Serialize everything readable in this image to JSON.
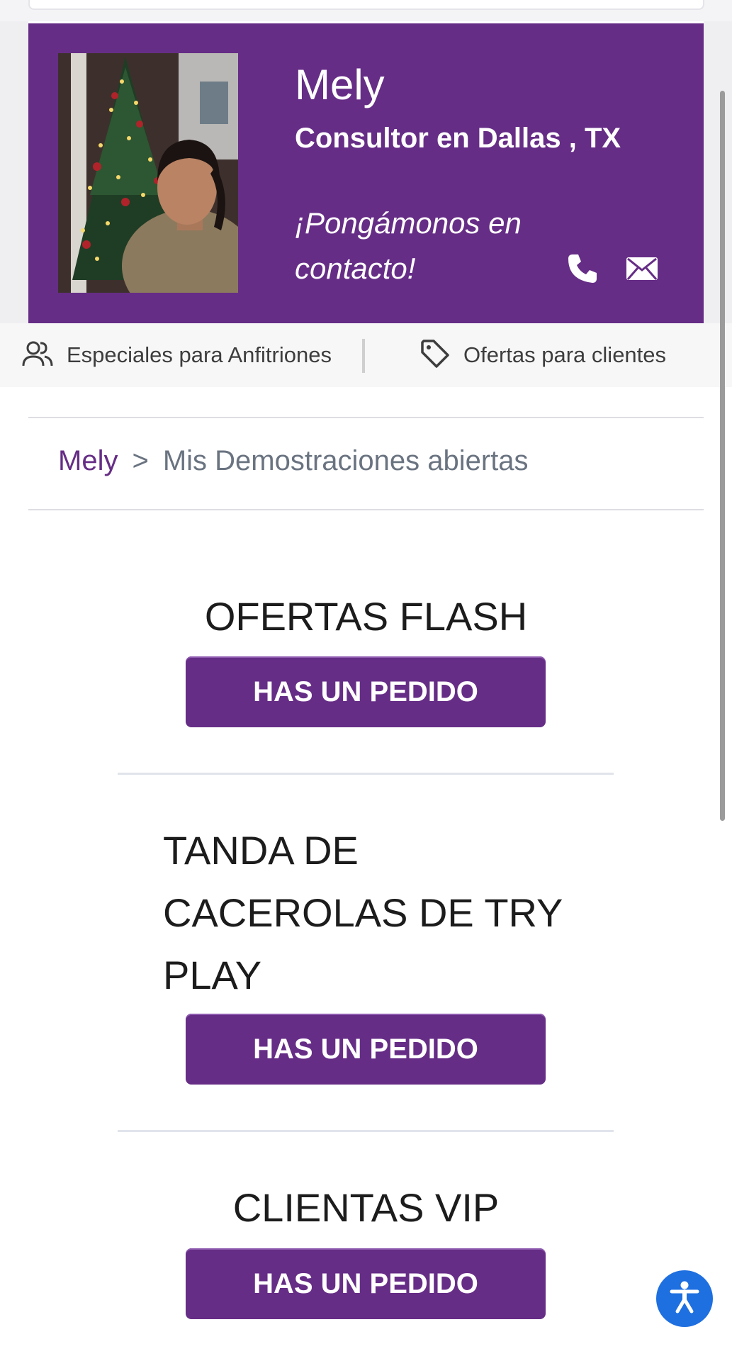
{
  "profile": {
    "name": "Mely",
    "location": "Consultor en Dallas , TX",
    "contact_prompt_line1": "¡Pongámonos en",
    "contact_prompt_line2": "contacto!",
    "phone_icon": "phone-icon",
    "email_icon": "envelope-icon"
  },
  "links_bar": {
    "hosts_label": "Especiales para Anfitriones",
    "hosts_icon": "people-icon",
    "offers_label": "Ofertas para clientes",
    "offers_icon": "tag-icon"
  },
  "breadcrumb": {
    "home": "Mely",
    "separator": ">",
    "current": "Mis Demostraciones abiertas"
  },
  "sections": [
    {
      "title": "OFERTAS FLASH",
      "button_label": "HAS UN PEDIDO"
    },
    {
      "title_lines": [
        "TANDA DE",
        "CACEROLAS DE TRY",
        "PLAY"
      ],
      "button_label": "HAS UN PEDIDO"
    },
    {
      "title": "CLIENTAS VIP",
      "button_label": "HAS UN PEDIDO"
    }
  ],
  "accessibility": {
    "icon": "accessibility-icon"
  },
  "colors": {
    "brand_purple": "#662d86",
    "accessibility_blue": "#1e6fe0",
    "muted_text": "#6a7380"
  }
}
